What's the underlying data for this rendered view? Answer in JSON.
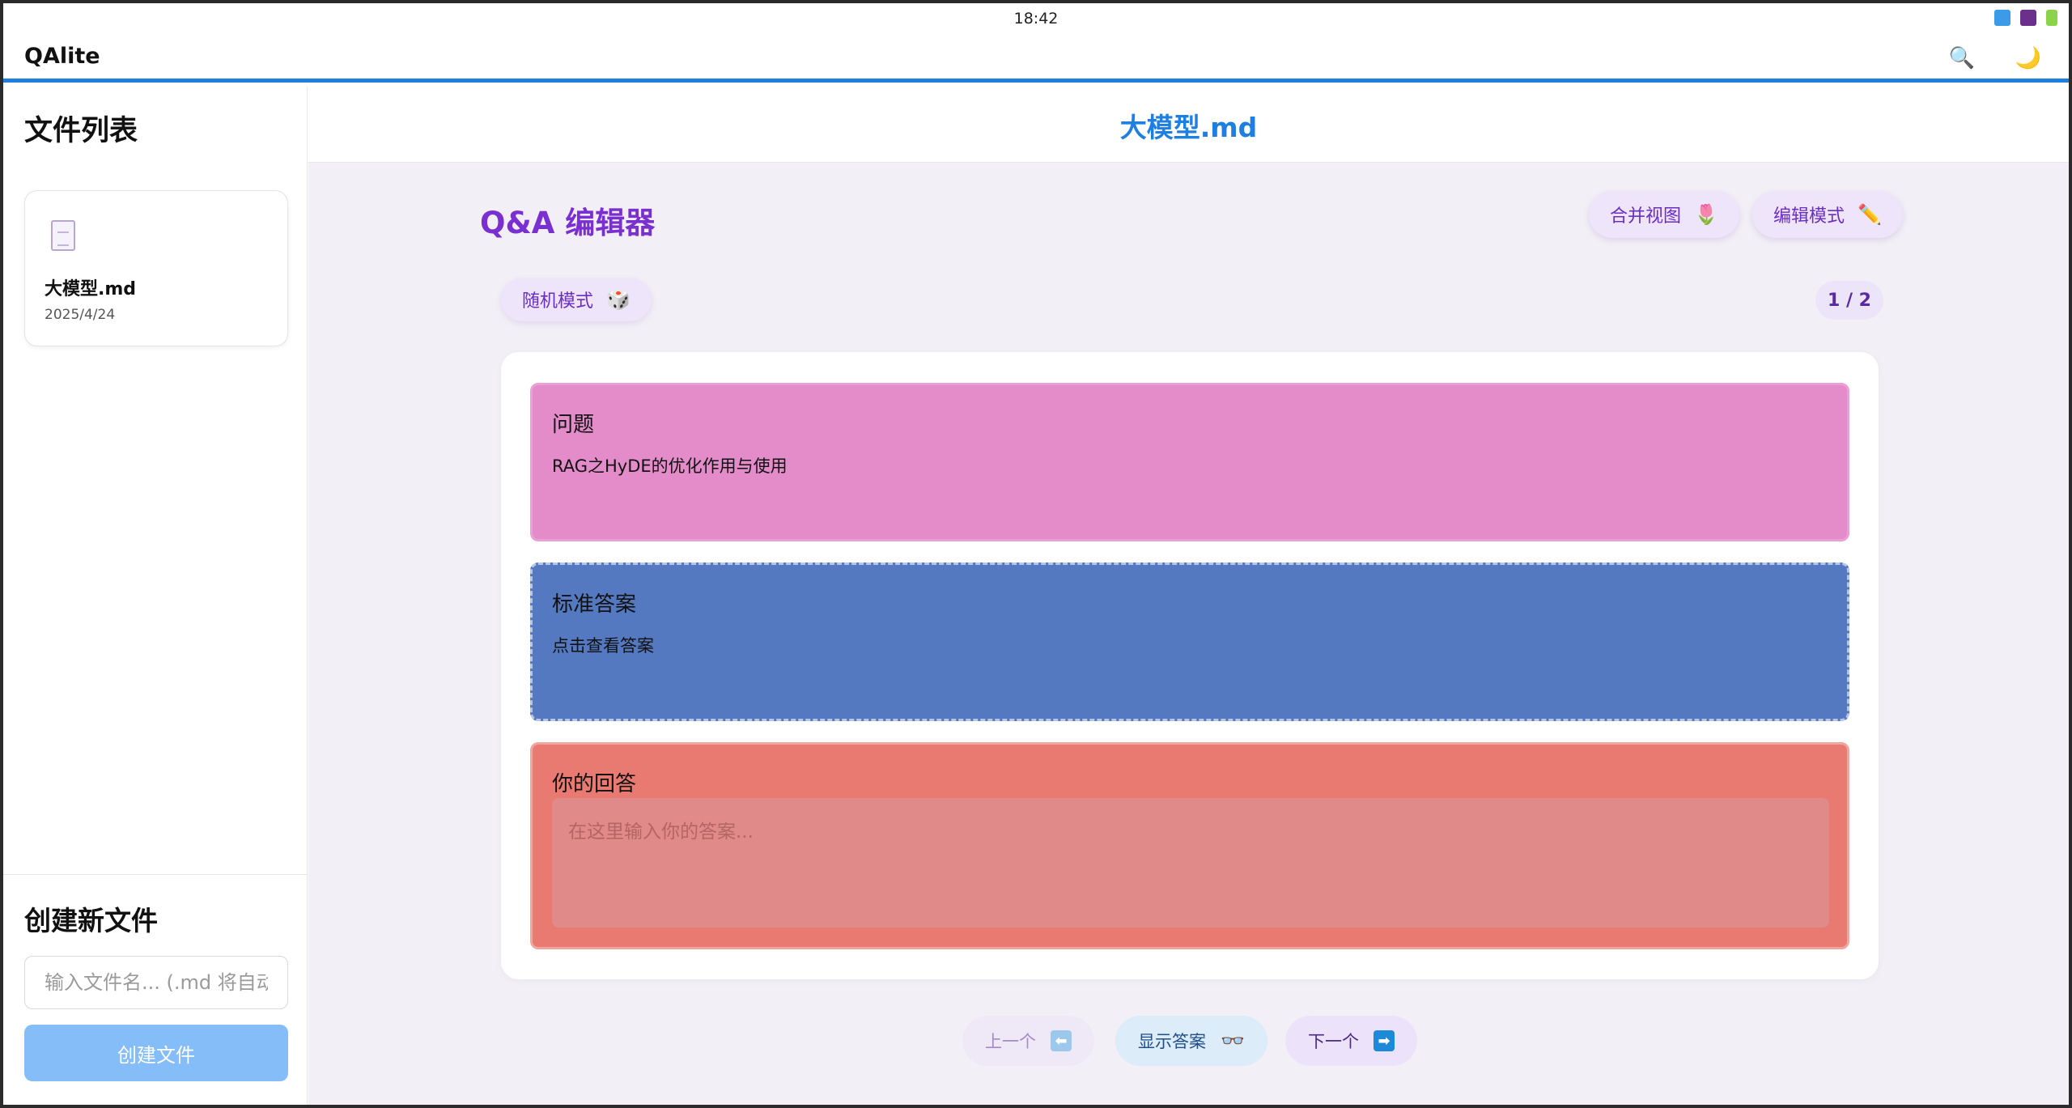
{
  "statusbar": {
    "time": "18:42"
  },
  "app": {
    "title": "QAlite",
    "search_icon": "🔍",
    "theme_icon": "🌙"
  },
  "sidebar": {
    "title": "文件列表",
    "files": [
      {
        "name": "大模型.md",
        "date": "2025/4/24"
      }
    ],
    "create": {
      "title": "创建新文件",
      "input_placeholder": "输入文件名... (.md 将自动添加)",
      "button_label": "创建文件"
    }
  },
  "main": {
    "doc_title": "大模型.md",
    "editor_title": "Q&A 编辑器",
    "merge_view": {
      "label": "合并视图",
      "icon": "🌷"
    },
    "edit_mode": {
      "label": "编辑模式",
      "icon": "✏️"
    },
    "random_mode": {
      "label": "随机模式",
      "icon": "🎲"
    },
    "counter": "1 / 2",
    "question": {
      "label": "问题",
      "text": "RAG之HyDE的优化作用与使用"
    },
    "standard_answer": {
      "label": "标准答案",
      "text": "点击查看答案"
    },
    "your_answer": {
      "label": "你的回答",
      "placeholder": "在这里输入你的答案..."
    },
    "nav": {
      "prev": {
        "label": "上一个",
        "icon": "⬅"
      },
      "show": {
        "label": "显示答案",
        "icon": "👓"
      },
      "next": {
        "label": "下一个",
        "icon": "➡"
      }
    }
  },
  "colors": {
    "accent": "#1e7fe0",
    "question_bg": "#e48bca",
    "answer_bg": "#5479c1",
    "response_bg": "#e97a72",
    "editor_title": "#7a2fd0"
  }
}
